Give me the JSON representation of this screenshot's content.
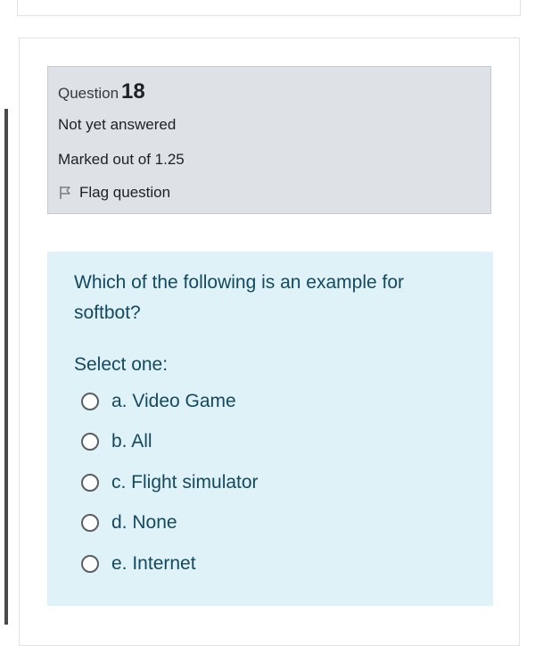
{
  "question": {
    "heading_label": "Question",
    "number": "18",
    "status": "Not yet answered",
    "marks": "Marked out of 1.25",
    "flag_label": "Flag question"
  },
  "formulation": {
    "text": "Which of the following is an example for softbot?",
    "prompt": "Select one:",
    "options": [
      {
        "label": "a. Video Game",
        "selected": false
      },
      {
        "label": "b. All",
        "selected": false
      },
      {
        "label": "c. Flight simulator",
        "selected": false
      },
      {
        "label": "d. None",
        "selected": false
      },
      {
        "label": "e. Internet",
        "selected": false
      }
    ]
  },
  "icons": {
    "flag": "flag-outline-icon",
    "radio": "radio-empty"
  },
  "colors": {
    "info_bg": "#dee2e6",
    "formulation_bg": "#def2f8",
    "formulation_text": "#14495f"
  }
}
